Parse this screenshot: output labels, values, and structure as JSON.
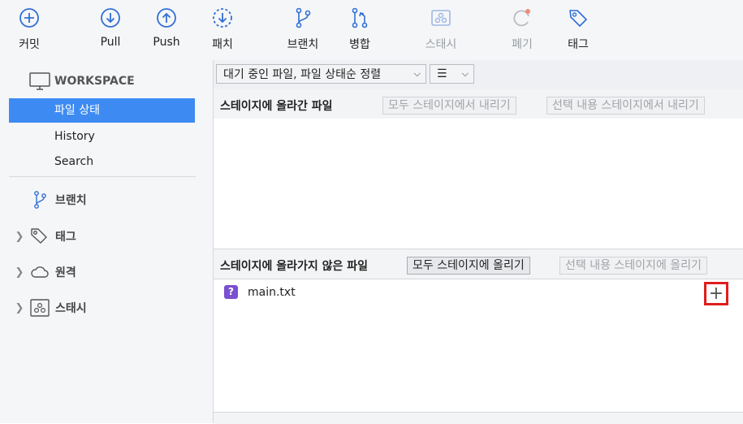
{
  "toolbar": {
    "commit": "커밋",
    "pull": "Pull",
    "push": "Push",
    "fetch": "패치",
    "branch": "브랜치",
    "merge": "병합",
    "stash": "스태시",
    "discard": "폐기",
    "tag": "태그"
  },
  "sidebar": {
    "workspace": "WORKSPACE",
    "items": [
      "파일 상태",
      "History",
      "Search"
    ],
    "groups": {
      "branches": "브랜치",
      "tags": "태그",
      "remotes": "원격",
      "stashes": "스태시"
    }
  },
  "filter": {
    "sort_label": "대기 중인 파일, 파일 상태순 정렬",
    "view_icon": "☰"
  },
  "staged": {
    "title": "스테이지에 올라간 파일",
    "unstage_all": "모두 스테이지에서 내리기",
    "unstage_selected": "선택 내용 스테이지에서 내리기"
  },
  "unstaged": {
    "title": "스테이지에 올라가지 않은 파일",
    "stage_all": "모두 스테이지에 올리기",
    "stage_selected": "선택 내용 스테이지에 올리기",
    "files": [
      {
        "name": "main.txt",
        "status_icon": "?"
      }
    ]
  },
  "colors": {
    "accent": "#3d8bf2",
    "icon_blue": "#2f6fd6",
    "untracked": "#7a4fd1",
    "highlight": "#e01d1d"
  }
}
